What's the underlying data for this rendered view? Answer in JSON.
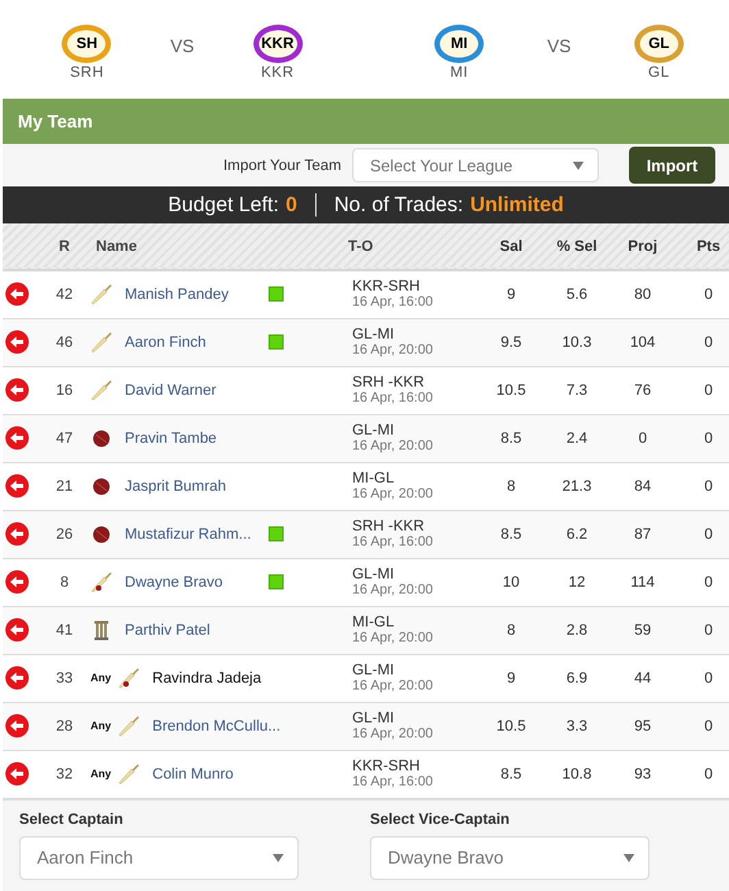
{
  "matches": [
    {
      "home": {
        "logo": "SH",
        "name": "SRH",
        "color": "#e8a317"
      },
      "vs": "VS",
      "away": {
        "logo": "KKR",
        "name": "KKR",
        "color": "#a02cd0"
      }
    },
    {
      "home": {
        "logo": "MI",
        "name": "MI",
        "color": "#2a8fd8"
      },
      "vs": "VS",
      "away": {
        "logo": "GL",
        "name": "GL",
        "color": "#d9a033"
      }
    }
  ],
  "panel": {
    "title": "My Team"
  },
  "import": {
    "label": "Import Your Team",
    "placeholder": "Select Your League",
    "button": "Import"
  },
  "budget": {
    "label": "Budget Left:",
    "value": "0",
    "trades_label": "No. of Trades:",
    "trades_value": "Unlimited"
  },
  "table": {
    "columns": [
      "R",
      "Name",
      "T-O",
      "Sal",
      "% Sel",
      "Proj",
      "Pts"
    ],
    "rows": [
      {
        "r": "42",
        "kind": "bat",
        "any": false,
        "name": "Manish Pandey",
        "emphasized": false,
        "flagged": true,
        "match": "KKR-SRH",
        "time": "16 Apr, 16:00",
        "sal": "9",
        "sel": "5.6",
        "proj": "80",
        "pts": "0"
      },
      {
        "r": "46",
        "kind": "bat",
        "any": false,
        "name": "Aaron Finch",
        "emphasized": false,
        "flagged": true,
        "match": "GL-MI",
        "time": "16 Apr, 20:00",
        "sal": "9.5",
        "sel": "10.3",
        "proj": "104",
        "pts": "0"
      },
      {
        "r": "16",
        "kind": "bat",
        "any": false,
        "name": "David Warner",
        "emphasized": false,
        "flagged": false,
        "match": "SRH -KKR",
        "time": "16 Apr, 16:00",
        "sal": "10.5",
        "sel": "7.3",
        "proj": "76",
        "pts": "0"
      },
      {
        "r": "47",
        "kind": "ball",
        "any": false,
        "name": "Pravin Tambe",
        "emphasized": false,
        "flagged": false,
        "match": "GL-MI",
        "time": "16 Apr, 20:00",
        "sal": "8.5",
        "sel": "2.4",
        "proj": "0",
        "pts": "0"
      },
      {
        "r": "21",
        "kind": "ball",
        "any": false,
        "name": "Jasprit Bumrah",
        "emphasized": false,
        "flagged": false,
        "match": "MI-GL",
        "time": "16 Apr, 20:00",
        "sal": "8",
        "sel": "21.3",
        "proj": "84",
        "pts": "0"
      },
      {
        "r": "26",
        "kind": "ball",
        "any": false,
        "name": "Mustafizur Rahm...",
        "emphasized": false,
        "flagged": true,
        "match": "SRH -KKR",
        "time": "16 Apr, 16:00",
        "sal": "8.5",
        "sel": "6.2",
        "proj": "87",
        "pts": "0"
      },
      {
        "r": "8",
        "kind": "allrounder",
        "any": false,
        "name": "Dwayne Bravo",
        "emphasized": false,
        "flagged": true,
        "match": "GL-MI",
        "time": "16 Apr, 20:00",
        "sal": "10",
        "sel": "12",
        "proj": "114",
        "pts": "0"
      },
      {
        "r": "41",
        "kind": "keeper",
        "any": false,
        "name": "Parthiv Patel",
        "emphasized": false,
        "flagged": false,
        "match": "MI-GL",
        "time": "16 Apr, 20:00",
        "sal": "8",
        "sel": "2.8",
        "proj": "59",
        "pts": "0"
      },
      {
        "r": "33",
        "kind": "allrounder",
        "any": true,
        "any_label": "Any",
        "name": "Ravindra Jadeja",
        "emphasized": true,
        "flagged": false,
        "match": "GL-MI",
        "time": "16 Apr, 20:00",
        "sal": "9",
        "sel": "6.9",
        "proj": "44",
        "pts": "0"
      },
      {
        "r": "28",
        "kind": "bat",
        "any": true,
        "any_label": "Any",
        "name": "Brendon McCullu...",
        "emphasized": false,
        "flagged": false,
        "match": "GL-MI",
        "time": "16 Apr, 20:00",
        "sal": "10.5",
        "sel": "3.3",
        "proj": "95",
        "pts": "0"
      },
      {
        "r": "32",
        "kind": "bat",
        "any": true,
        "any_label": "Any",
        "name": "Colin Munro",
        "emphasized": false,
        "flagged": false,
        "match": "KKR-SRH",
        "time": "16 Apr, 16:00",
        "sal": "8.5",
        "sel": "10.8",
        "proj": "93",
        "pts": "0"
      }
    ]
  },
  "captain": {
    "label": "Select Captain",
    "value": "Aaron Finch"
  },
  "vice_captain": {
    "label": "Select Vice-Captain",
    "value": "Dwayne Bravo"
  }
}
